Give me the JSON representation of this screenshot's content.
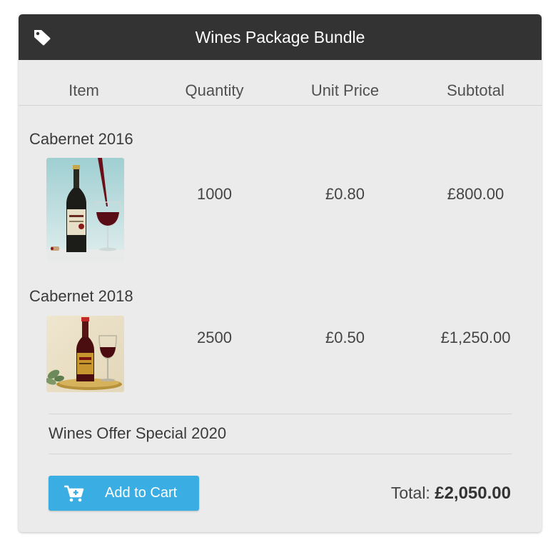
{
  "header": {
    "icon": "tag-icon",
    "title": "Wines Package Bundle"
  },
  "columns": [
    "Item",
    "Quantity",
    "Unit Price",
    "Subtotal"
  ],
  "items": [
    {
      "name": "Cabernet 2016",
      "image": "wine-bottle-glass-photo",
      "quantity": "1000",
      "unit_price": "£0.80",
      "subtotal": "£800.00"
    },
    {
      "name": "Cabernet 2018",
      "image": "wine-bottle-tray-photo",
      "quantity": "2500",
      "unit_price": "£0.50",
      "subtotal": "£1,250.00"
    }
  ],
  "offer": {
    "name": "Wines Offer Special 2020"
  },
  "cart_button": {
    "icon": "cart-add-icon",
    "label": "Add to Cart"
  },
  "total": {
    "label": "Total:",
    "value": "£2,050.00"
  },
  "colors": {
    "header_bg": "#333333",
    "card_bg": "#ebebeb",
    "button_bg": "#3aaee3"
  }
}
